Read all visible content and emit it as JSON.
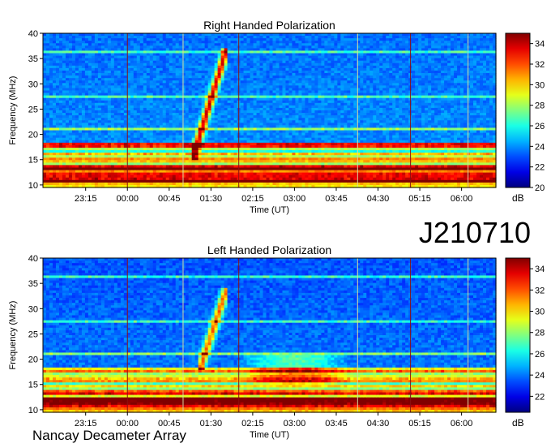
{
  "date_code": "J210710",
  "footer": "Nancay Decameter Array",
  "chart_data": [
    {
      "type": "heatmap",
      "title": "Right Handed Polarization",
      "xlabel": "Time (UT)",
      "ylabel": "Frequency (MHz)",
      "x_ticks": [
        "23:15",
        "00:00",
        "00:45",
        "01:30",
        "02:15",
        "03:00",
        "03:45",
        "04:30",
        "05:15",
        "06:00"
      ],
      "x_tick_minutes": [
        -45,
        0,
        45,
        90,
        135,
        180,
        225,
        270,
        315,
        360
      ],
      "xlim_minutes": [
        -91,
        397
      ],
      "y_ticks": [
        10,
        15,
        20,
        25,
        30,
        35,
        40
      ],
      "ylim": [
        9.5,
        40
      ],
      "colorbar": {
        "label": "dB",
        "ticks": [
          20,
          22,
          24,
          26,
          28,
          30,
          32,
          34
        ],
        "range": [
          20,
          35
        ]
      },
      "features": {
        "burst": {
          "start_min": 70,
          "end_min": 107,
          "f_min": 15,
          "f_max": 37,
          "peak_db": 34
        },
        "rfi_lines_mhz": [
          36.3,
          27.5,
          21.0,
          17.8,
          16.0,
          13.5,
          12.0,
          11.0
        ],
        "vertical_lines_min": [
          0,
          60,
          120,
          248,
          305,
          367
        ]
      }
    },
    {
      "type": "heatmap",
      "title": "Left Handed Polarization",
      "xlabel": "Time (UT)",
      "ylabel": "Frequency (MHz)",
      "x_ticks": [
        "23:15",
        "00:00",
        "00:45",
        "01:30",
        "02:15",
        "03:00",
        "03:45",
        "04:30",
        "05:15",
        "06:00"
      ],
      "x_tick_minutes": [
        -45,
        0,
        45,
        90,
        135,
        180,
        225,
        270,
        315,
        360
      ],
      "xlim_minutes": [
        -91,
        397
      ],
      "y_ticks": [
        10,
        15,
        20,
        25,
        30,
        35,
        40
      ],
      "ylim": [
        9.5,
        40
      ],
      "colorbar": {
        "label": "dB",
        "ticks": [
          22,
          24,
          26,
          28,
          30,
          32,
          34
        ],
        "range": [
          20.5,
          35
        ]
      },
      "features": {
        "burst": {
          "start_min": 78,
          "end_min": 107,
          "f_min": 18,
          "f_max": 34,
          "peak_db": 32
        },
        "rfi_lines_mhz": [
          36.3,
          27.5,
          21.0,
          17.8,
          16.0,
          13.5,
          12.0,
          11.0
        ],
        "vertical_lines_min": [
          0,
          60,
          120,
          248,
          305,
          367
        ],
        "diffuse_emission": {
          "start_min": 120,
          "end_min": 240,
          "f_min": 15,
          "f_max": 21
        }
      }
    }
  ]
}
